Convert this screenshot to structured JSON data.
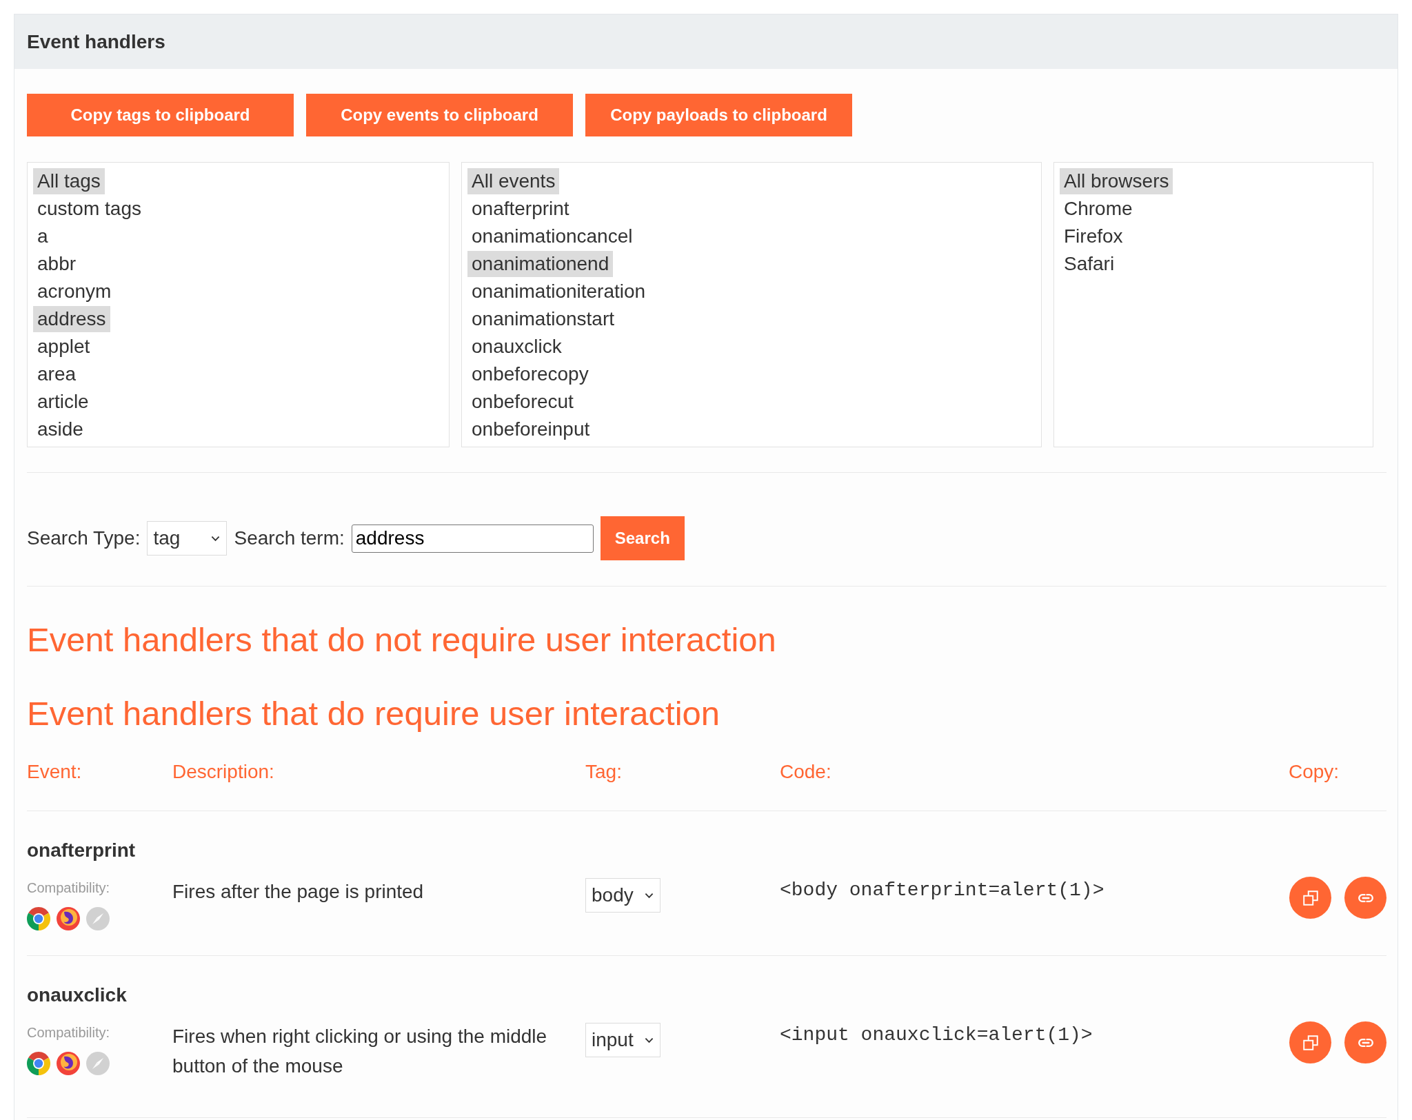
{
  "panel": {
    "title": "Event handlers"
  },
  "copy_buttons": [
    "Copy tags to clipboard",
    "Copy events to clipboard",
    "Copy payloads to clipboard"
  ],
  "filters": [
    {
      "items": [
        {
          "label": "All tags",
          "selected": true
        },
        {
          "label": "custom tags",
          "selected": false
        },
        {
          "label": "a",
          "selected": false
        },
        {
          "label": "abbr",
          "selected": false
        },
        {
          "label": "acronym",
          "selected": false
        },
        {
          "label": "address",
          "selected": true
        },
        {
          "label": "applet",
          "selected": false
        },
        {
          "label": "area",
          "selected": false
        },
        {
          "label": "article",
          "selected": false
        },
        {
          "label": "aside",
          "selected": false
        }
      ]
    },
    {
      "items": [
        {
          "label": "All events",
          "selected": true
        },
        {
          "label": "onafterprint",
          "selected": false
        },
        {
          "label": "onanimationcancel",
          "selected": false
        },
        {
          "label": "onanimationend",
          "selected": true
        },
        {
          "label": "onanimationiteration",
          "selected": false
        },
        {
          "label": "onanimationstart",
          "selected": false
        },
        {
          "label": "onauxclick",
          "selected": false
        },
        {
          "label": "onbeforecopy",
          "selected": false
        },
        {
          "label": "onbeforecut",
          "selected": false
        },
        {
          "label": "onbeforeinput",
          "selected": false
        }
      ]
    },
    {
      "items": [
        {
          "label": "All browsers",
          "selected": true
        },
        {
          "label": "Chrome",
          "selected": false
        },
        {
          "label": "Firefox",
          "selected": false
        },
        {
          "label": "Safari",
          "selected": false
        }
      ]
    }
  ],
  "search": {
    "type_label": "Search Type:",
    "type_value": "tag",
    "term_label": "Search term:",
    "term_value": "address",
    "button": "Search"
  },
  "headings": [
    "Event handlers that do not require user interaction",
    "Event handlers that do require user interaction"
  ],
  "table": {
    "columns": [
      "Event:",
      "Description:",
      "Tag:",
      "Code:",
      "Copy:"
    ],
    "rows": [
      {
        "event": "onafterprint",
        "compatibility_label": "Compatibility:",
        "browsers": [
          {
            "kind": "chrome",
            "supported": true
          },
          {
            "kind": "firefox",
            "supported": true
          },
          {
            "kind": "safari",
            "supported": false
          }
        ],
        "description": "Fires after the page is printed",
        "tag": "body",
        "code": "<body onafterprint=alert(1)>"
      },
      {
        "event": "onauxclick",
        "compatibility_label": "Compatibility:",
        "browsers": [
          {
            "kind": "chrome",
            "supported": true
          },
          {
            "kind": "firefox",
            "supported": true
          },
          {
            "kind": "safari",
            "supported": false
          }
        ],
        "description": "Fires when right clicking or using the middle button of the mouse",
        "tag": "input",
        "code": "<input onauxclick=alert(1)>"
      }
    ]
  }
}
